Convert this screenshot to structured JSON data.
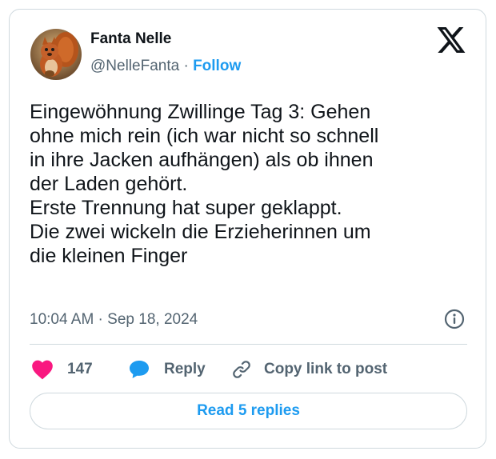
{
  "author": {
    "name": "Fanta Nelle",
    "handle": "@NelleFanta",
    "separator": "·",
    "follow_label": "Follow"
  },
  "tweet": {
    "lines": [
      "Eingewöhnung Zwillinge Tag 3: Gehen",
      "ohne mich rein (ich war nicht so schnell",
      "in ihre Jacken aufhängen) als ob ihnen",
      "der Laden gehört.",
      "Erste Trennung hat super geklappt.",
      "Die zwei wickeln die Erzieherinnen um",
      "die kleinen Finger"
    ],
    "timestamp": "10:04 AM · Sep 18, 2024"
  },
  "actions": {
    "like_count": "147",
    "reply_label": "Reply",
    "copy_link_label": "Copy link to post"
  },
  "read_replies_label": "Read 5 replies",
  "icons": {
    "brand": "x-logo-icon",
    "info": "info-icon",
    "like": "heart-icon",
    "reply": "speech-bubble-icon",
    "copy": "link-icon"
  },
  "colors": {
    "accent": "#1d9bf0",
    "heart": "#f91880",
    "text": "#0f1419",
    "secondary": "#536471",
    "border": "#cfd9de"
  }
}
